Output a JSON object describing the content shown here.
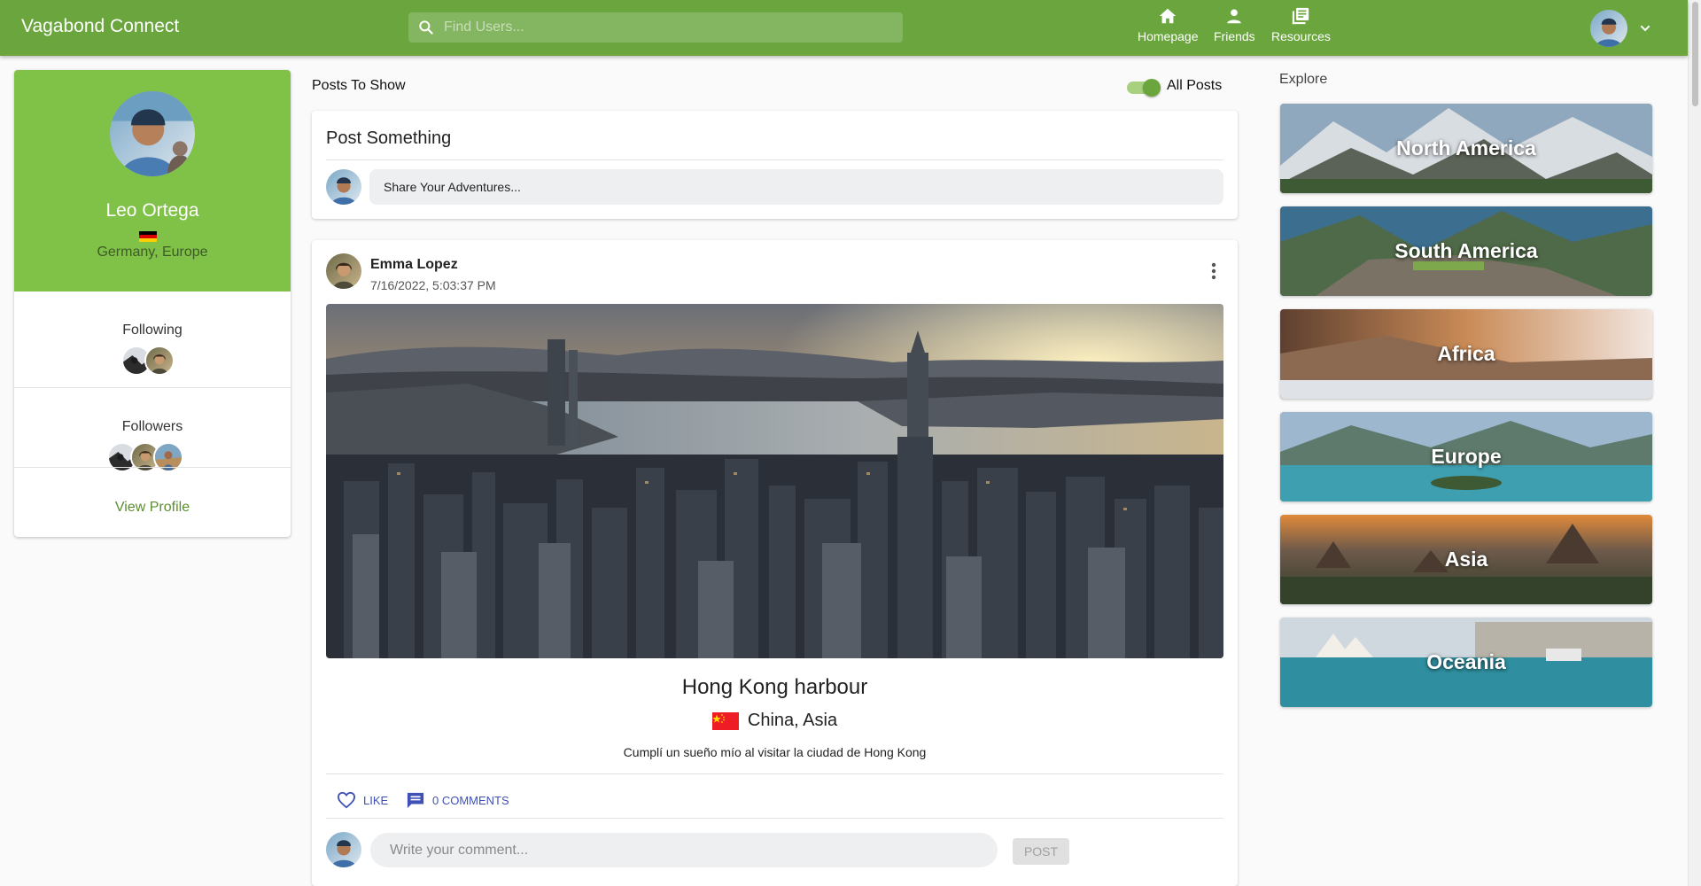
{
  "app": {
    "title": "Vagabond Connect"
  },
  "colors": {
    "brand": "#6aa53d",
    "profile_header": "#80c148",
    "link": "#5b8f2f",
    "action": "#3f51b5"
  },
  "search": {
    "placeholder": "Find Users...",
    "icon": "search-icon"
  },
  "nav": {
    "items": [
      {
        "label": "Homepage",
        "icon": "home-icon"
      },
      {
        "label": "Friends",
        "icon": "person-icon"
      },
      {
        "label": "Resources",
        "icon": "library-books-icon"
      }
    ],
    "account_icon": "chevron-down-icon"
  },
  "profile": {
    "name": "Leo Ortega",
    "location": "Germany, Europe",
    "flag": "germany-flag",
    "following_label": "Following",
    "following_count": 2,
    "followers_label": "Followers",
    "followers_count": 3,
    "view_profile_label": "View Profile"
  },
  "feed": {
    "posts_to_show_label": "Posts To Show",
    "toggle_label": "All Posts",
    "toggle_on": true,
    "post_something": {
      "title": "Post Something",
      "placeholder": "Share Your Adventures..."
    },
    "posts": [
      {
        "author": "Emma Lopez",
        "date": "7/16/2022, 5:03:37 PM",
        "title": "Hong Kong harbour",
        "location": "China, Asia",
        "flag": "china-flag",
        "text": "Cumplí un sueño mío al visitar la ciudad de Hong Kong",
        "like_label": "LIKE",
        "comments_label": "0 COMMENTS",
        "comment_placeholder": "Write your comment...",
        "comment_button": "POST"
      }
    ]
  },
  "explore": {
    "title": "Explore",
    "regions": [
      "North America",
      "South America",
      "Africa",
      "Europe",
      "Asia",
      "Oceania"
    ]
  }
}
